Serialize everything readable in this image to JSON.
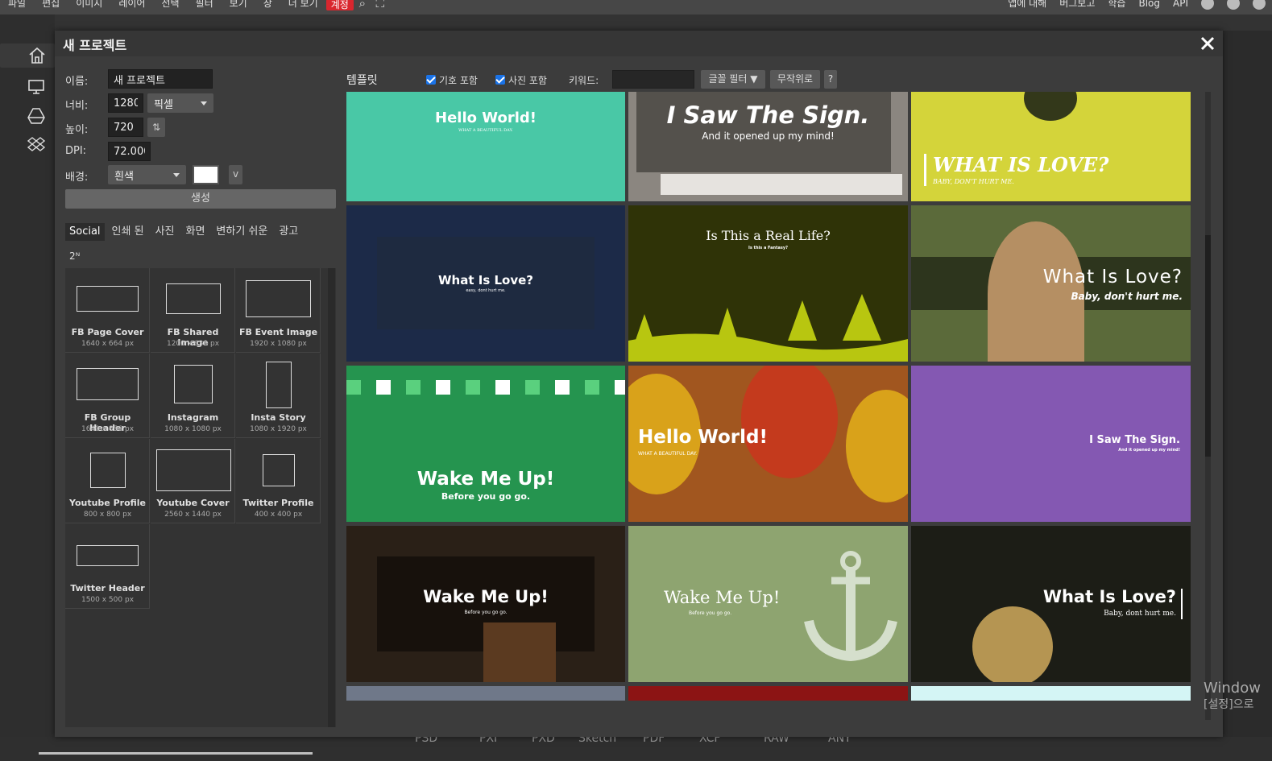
{
  "menu": {
    "items": [
      "파일",
      "편집",
      "이미지",
      "레이어",
      "선택",
      "필터",
      "보기",
      "창",
      "더 보기",
      "계정"
    ],
    "right": [
      "앱에 대해",
      "버그보고",
      "학습",
      "Blog",
      "API"
    ]
  },
  "dialog": {
    "title": "새 프로젝트",
    "form": {
      "name_label": "이름:",
      "name_value": "새 프로젝트",
      "width_label": "너비:",
      "width_value": "1280",
      "unit": "픽셀",
      "height_label": "높이:",
      "height_value": "720",
      "dpi_label": "DPI:",
      "dpi_value": "72.000",
      "bg_label": "배경:",
      "bg_value": "흰색",
      "bg_color": "#ffffff",
      "bg_more": "v",
      "create": "생성"
    },
    "categories": [
      "Social",
      "인쇄 된",
      "사진",
      "화면",
      "변하기 쉬운",
      "광고"
    ],
    "cat_extra": "2ᴺ",
    "presets": [
      {
        "name": "FB Page Cover",
        "size": "1640 x 664 px"
      },
      {
        "name": "FB Shared Image",
        "size": "1200 x 630 px"
      },
      {
        "name": "FB Event Image",
        "size": "1920 x 1080 px"
      },
      {
        "name": "FB Group Header",
        "size": "1640 x 856 px"
      },
      {
        "name": "Instagram",
        "size": "1080 x 1080 px"
      },
      {
        "name": "Insta Story",
        "size": "1080 x 1920 px"
      },
      {
        "name": "Youtube Profile",
        "size": "800 x 800 px"
      },
      {
        "name": "Youtube Cover",
        "size": "2560 x 1440 px"
      },
      {
        "name": "Twitter Profile",
        "size": "400 x 400 px"
      },
      {
        "name": "Twitter Header",
        "size": "1500 x 500 px"
      }
    ],
    "templates": {
      "label": "템플릿",
      "include_symbols": "기호 포함",
      "include_photos": "사진 포함",
      "keyword_label": "키워드:",
      "font_filter": "글꼴 필터",
      "random": "무작위로",
      "help": "?",
      "tiles": [
        {
          "title": "Hello World!",
          "sub": "WHAT A BEAUTIFUL DAY.",
          "bg": "#49c8a6"
        },
        {
          "title": "I Saw The Sign.",
          "sub": "And it opened up my mind!",
          "bg": "#8b8680"
        },
        {
          "title": "WHAT IS LOVE?",
          "sub": "BABY, DON'T HURT ME.",
          "bg": "#d4d43a"
        },
        {
          "title": "What Is Love?",
          "sub": "easy, dont hurt me.",
          "bg": "#1c2a48"
        },
        {
          "title": "Is This a Real Life?",
          "sub": "Is this a Fantasy?",
          "bg": "#2f3307"
        },
        {
          "title": "What Is Love?",
          "sub": "Baby, don't hurt me.",
          "bg": "#5b6a3a"
        },
        {
          "title": "Wake Me Up!",
          "sub": "Before you go go.",
          "bg": "#25944f"
        },
        {
          "title": "Hello World!",
          "sub": "WHAT A BEAUTIFUL DAY.",
          "bg": "#a1561f"
        },
        {
          "title": "I Saw The Sign.",
          "sub": "And it opened up my mind!",
          "bg": "#8458b2"
        },
        {
          "title": "Wake Me Up!",
          "sub": "Before you go go.",
          "bg": "#2a2017"
        },
        {
          "title": "Wake Me Up!",
          "sub": "Before you go go.",
          "bg": "#8ea470"
        },
        {
          "title": "What Is Love?",
          "sub": "Baby, dont hurt me.",
          "bg": "#1c1d16"
        }
      ],
      "partial_tiles": [
        "#6f7889",
        "#8c1414",
        "#d4f5f5"
      ]
    }
  },
  "bottom_formats": [
    "PSD",
    "PXI",
    "PXD",
    "Sketch",
    "PDF",
    "XCF",
    "RAW",
    "ANY"
  ],
  "watermark": {
    "line1": "Window",
    "line2": "[설정]으로"
  }
}
